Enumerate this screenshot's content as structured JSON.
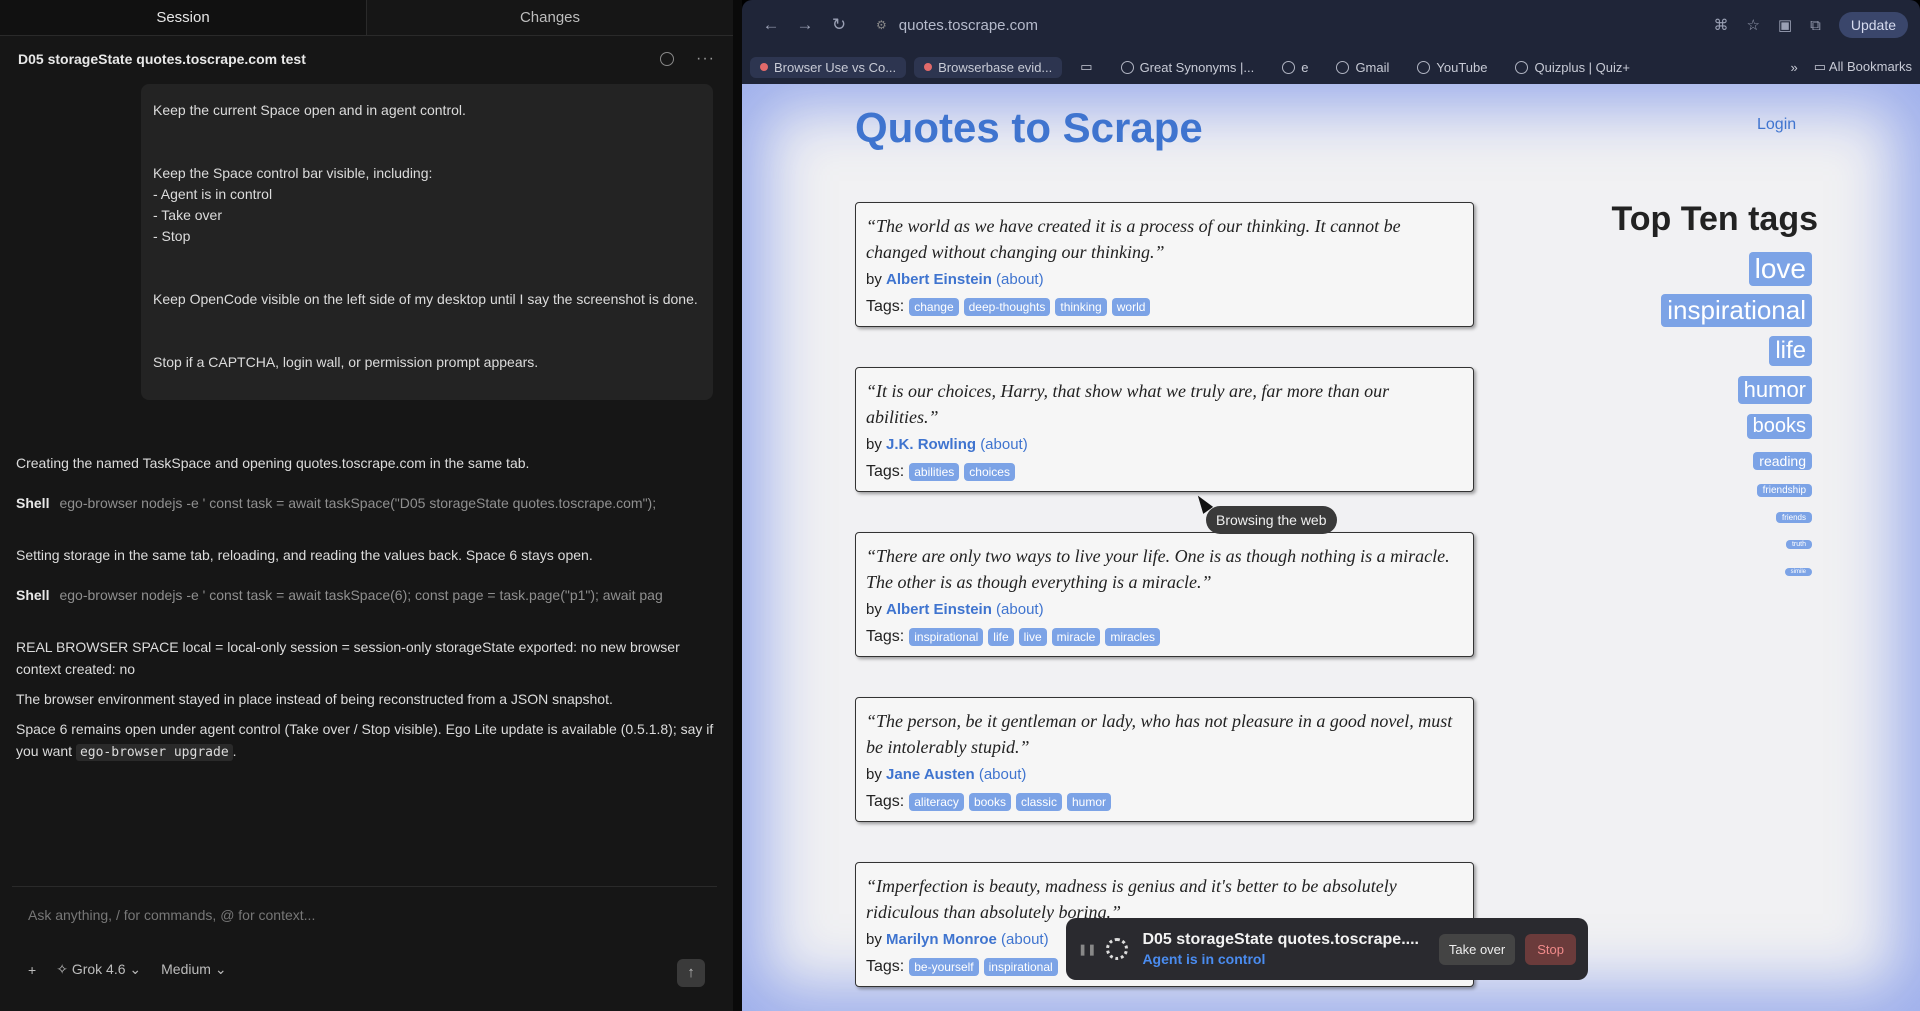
{
  "session": {
    "tabs": [
      "Session",
      "Changes"
    ],
    "title": "D05 storageState quotes.toscrape.com test",
    "message_lines": [
      "Keep the current Space open and in agent control.",
      "Keep the Space control bar visible, including:\n- Agent is in control\n- Take over\n- Stop",
      "Keep OpenCode visible on the left side of my desktop until I say the screenshot is done.",
      "Stop if a CAPTCHA, login wall, or permission prompt appears."
    ],
    "conv": {
      "line1": "Creating the named TaskSpace and opening quotes.toscrape.com in the same tab.",
      "shell1_label": "Shell",
      "shell1_cmd": "ego-browser nodejs -e ' const task = await taskSpace(\"D05 storageState quotes.toscrape.com\");",
      "line2": "Setting storage in the same tab, reloading, and reading the values back. Space 6 stays open.",
      "shell2_label": "Shell",
      "shell2_cmd": "ego-browser nodejs -e ' const task = await taskSpace(6); const page = task.page(\"p1\"); await pag",
      "line3": "REAL BROWSER SPACE local = local-only session = session-only storageState exported: no new browser context created: no",
      "line4": "The browser environment stayed in place instead of being reconstructed from a JSON snapshot.",
      "line5_pre": "Space 6 remains open under agent control (Take over / Stop visible). Ego Lite update is available (0.5.1.8); say if you want ",
      "line5_code": "ego-browser upgrade",
      "line5_post": "."
    },
    "composer": {
      "placeholder": "Ask anything, / for commands, @ for context...",
      "plus": "+",
      "model": "Grok 4.6",
      "effort": "Medium"
    }
  },
  "browser": {
    "url": "quotes.toscrape.com",
    "update": "Update",
    "bookmarks": [
      "Browser Use vs Co...",
      "Browserbase evid...",
      "Great Synonyms |...",
      "e",
      "Gmail",
      "YouTube",
      "Quizplus | Quiz+"
    ],
    "all_bookmarks": "All Bookmarks"
  },
  "site": {
    "title": "Quotes to Scrape",
    "login": "Login",
    "quotes": [
      {
        "text": "“The world as we have created it is a process of our thinking. It cannot be changed without changing our thinking.”",
        "author": "Albert Einstein",
        "tags": [
          "change",
          "deep-thoughts",
          "thinking",
          "world"
        ]
      },
      {
        "text": "“It is our choices, Harry, that show what we truly are, far more than our abilities.”",
        "author": "J.K. Rowling",
        "tags": [
          "abilities",
          "choices"
        ]
      },
      {
        "text": "“There are only two ways to live your life. One is as though nothing is a miracle. The other is as though everything is a miracle.”",
        "author": "Albert Einstein",
        "tags": [
          "inspirational",
          "life",
          "live",
          "miracle",
          "miracles"
        ]
      },
      {
        "text": "“The person, be it gentleman or lady, who has not pleasure in a good novel, must be intolerably stupid.”",
        "author": "Jane Austen",
        "tags": [
          "aliteracy",
          "books",
          "classic",
          "humor"
        ]
      },
      {
        "text": "“Imperfection is beauty, madness is genius and it's better to be absolutely ridiculous than absolutely boring.”",
        "author": "Marilyn Monroe",
        "tags": [
          "be-yourself",
          "inspirational"
        ]
      }
    ],
    "by": "by",
    "about": "(about)",
    "tags_label": "Tags:",
    "top_tags_title": "Top Ten tags",
    "top_tags": [
      "love",
      "inspirational",
      "life",
      "humor",
      "books",
      "reading",
      "friendship",
      "friends",
      "truth",
      "simile"
    ]
  },
  "tooltip": "Browsing the web",
  "agent_bar": {
    "title": "D05 storageState quotes.toscrape....",
    "status": "Agent is in control",
    "take_over": "Take over",
    "stop": "Stop"
  }
}
